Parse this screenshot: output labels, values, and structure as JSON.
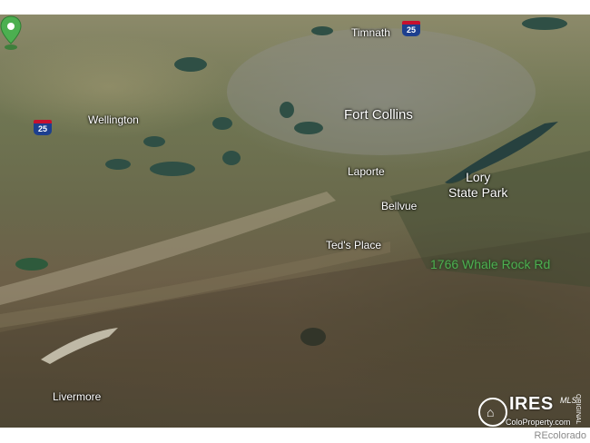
{
  "map": {
    "places": {
      "timnath": "Timnath",
      "wellington": "Wellington",
      "fort_collins": "Fort Collins",
      "laporte": "Laporte",
      "lory_state_park": "Lory\nState Park",
      "bellvue": "Bellvue",
      "teds_place": "Ted's Place",
      "livermore": "Livermore"
    },
    "highways": {
      "i25_north": "25",
      "i25_west": "25"
    },
    "pin": {
      "icon": "map-pin-icon",
      "color": "#4caf50"
    },
    "address": "1766 Whale Rock Rd"
  },
  "watermark": {
    "icon": "house-icon",
    "brand": "IRES",
    "mls": "MLS",
    "domain": "ColoProperty.com",
    "vertical_text": "ORIGINAL"
  },
  "credit": "REcolorado"
}
